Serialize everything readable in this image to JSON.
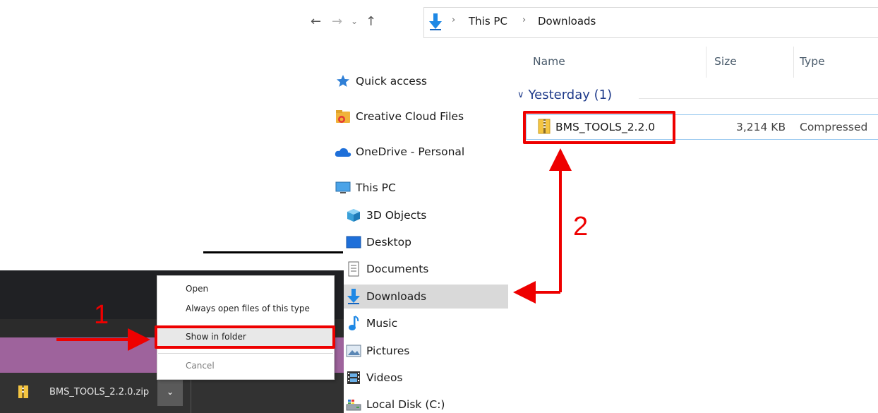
{
  "address_bar": {
    "crumbs": [
      "This PC",
      "Downloads"
    ]
  },
  "nav_pane": {
    "items": [
      {
        "label": "Quick access",
        "icon": "star-icon"
      },
      {
        "label": "Creative Cloud Files",
        "icon": "creative-cloud-icon"
      },
      {
        "label": "OneDrive - Personal",
        "icon": "cloud-icon"
      },
      {
        "label": "This PC",
        "icon": "computer-icon"
      },
      {
        "label": "3D Objects",
        "icon": "cube-icon"
      },
      {
        "label": "Desktop",
        "icon": "desktop-icon"
      },
      {
        "label": "Documents",
        "icon": "document-icon"
      },
      {
        "label": "Downloads",
        "icon": "download-arrow-icon",
        "selected": true
      },
      {
        "label": "Music",
        "icon": "music-note-icon"
      },
      {
        "label": "Pictures",
        "icon": "pictures-icon"
      },
      {
        "label": "Videos",
        "icon": "film-icon"
      },
      {
        "label": "Local Disk (C:)",
        "icon": "drive-icon"
      }
    ]
  },
  "file_list": {
    "columns": [
      "Name",
      "Size",
      "Type"
    ],
    "group": "Yesterday (1)",
    "files": [
      {
        "name": "BMS_TOOLS_2.2.0",
        "size": "3,214 KB",
        "type": "Compressed"
      }
    ]
  },
  "download_bar": {
    "file_name": "BMS_TOOLS_2.2.0.zip"
  },
  "context_menu": {
    "open": "Open",
    "always_open": "Always open files of this type",
    "show_in_folder": "Show in folder",
    "cancel": "Cancel"
  },
  "annotations": {
    "step1": "1",
    "step2": "2",
    "color": "#ee0000"
  }
}
